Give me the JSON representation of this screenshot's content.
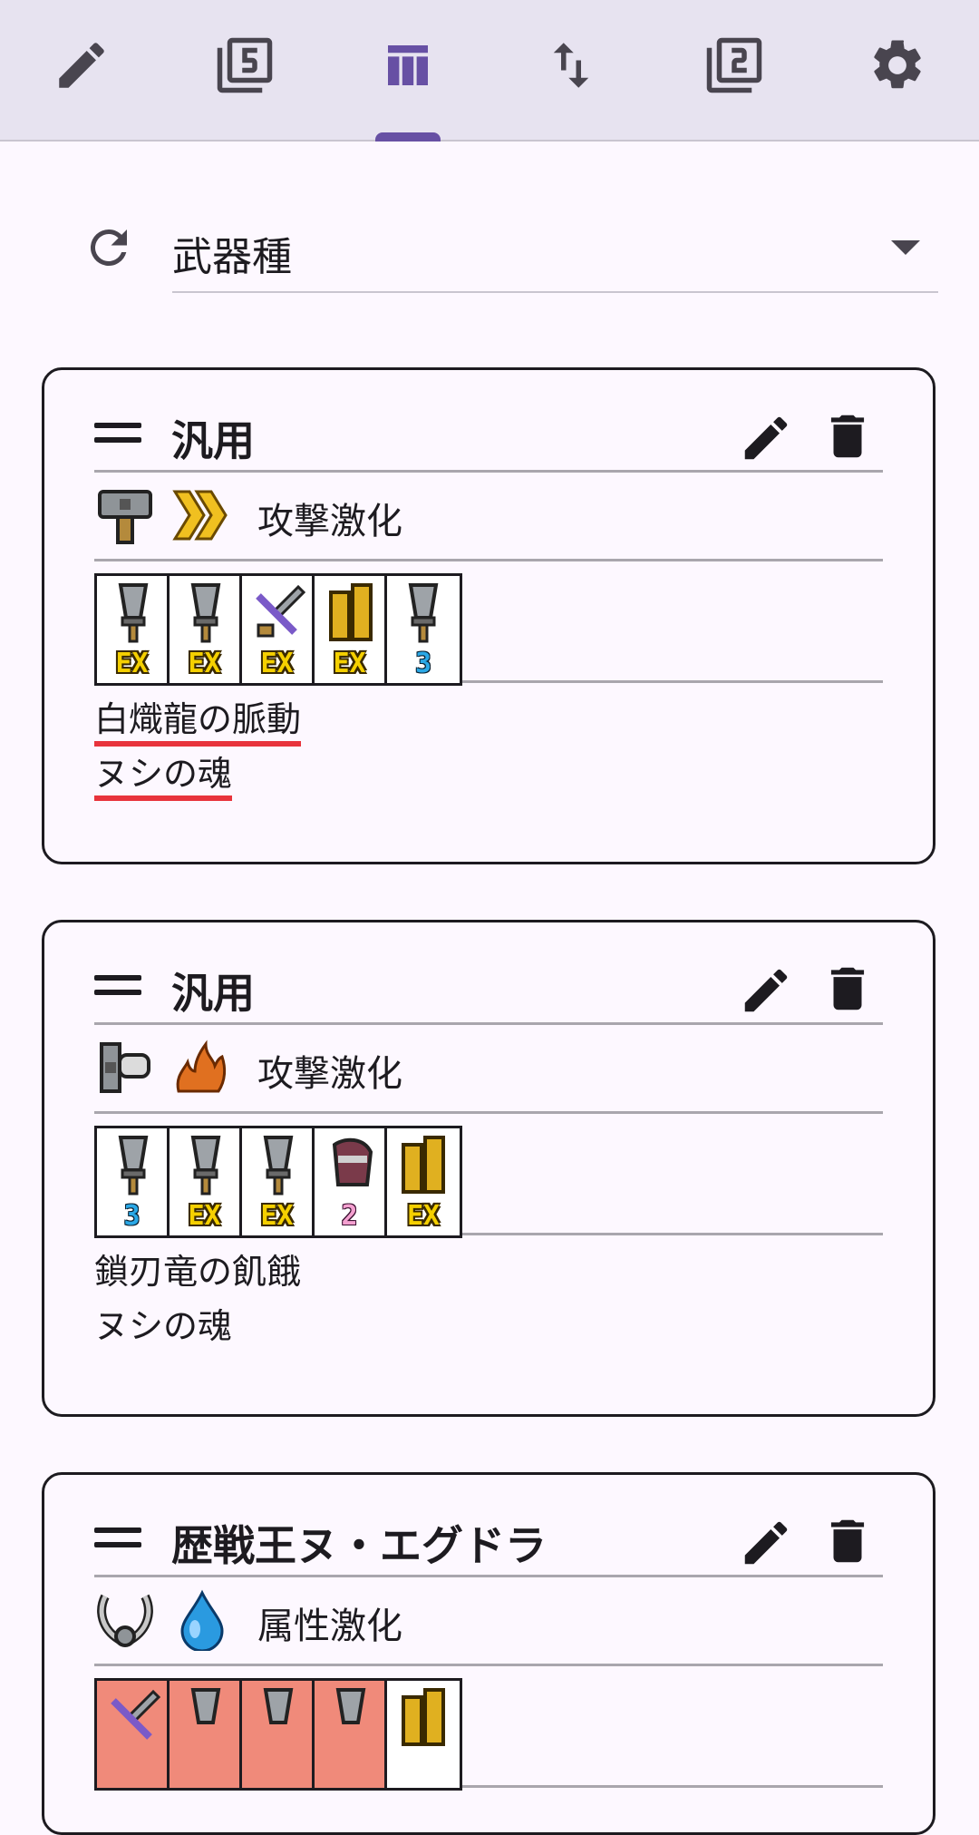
{
  "tabs": [
    {
      "name": "edit",
      "icon": "pencil-icon",
      "active": false
    },
    {
      "name": "filter-5",
      "icon": "filter-5-icon",
      "active": false
    },
    {
      "name": "table",
      "icon": "view-column-icon",
      "active": true
    },
    {
      "name": "sort",
      "icon": "swap-vert-icon",
      "active": false
    },
    {
      "name": "filter-2",
      "icon": "filter-2-icon",
      "active": false
    },
    {
      "name": "settings",
      "icon": "gear-icon",
      "active": false
    }
  ],
  "filter": {
    "value": "武器種"
  },
  "cards": [
    {
      "title": "汎用",
      "skill": "攻撃激化",
      "slots": [
        {
          "icon": "blade-icon",
          "tag": "EX"
        },
        {
          "icon": "blade-icon",
          "tag": "EX"
        },
        {
          "icon": "sword-icon",
          "tag": "EX"
        },
        {
          "icon": "armor-icon",
          "tag": "EX"
        },
        {
          "icon": "blade-icon",
          "tag": "3"
        }
      ],
      "notes": [
        "白熾龍の脈動",
        "ヌシの魂"
      ]
    },
    {
      "title": "汎用",
      "skill": "攻撃激化",
      "slots": [
        {
          "icon": "blade-icon",
          "tag": "3"
        },
        {
          "icon": "blade-icon",
          "tag": "EX"
        },
        {
          "icon": "blade-icon",
          "tag": "EX"
        },
        {
          "icon": "gauntlet-icon",
          "tag": "2"
        },
        {
          "icon": "armor-icon",
          "tag": "EX"
        }
      ],
      "notes": [
        "鎖刃竜の飢餓",
        "ヌシの魂"
      ]
    },
    {
      "title": "歴戦王ヌ・エグドラ",
      "skill": "属性激化"
    }
  ],
  "colors": {
    "accent": "#6750a4",
    "warn_underline": "#e8343c",
    "ex_text": "#f5d000",
    "slot_red": "#f08a7a"
  }
}
